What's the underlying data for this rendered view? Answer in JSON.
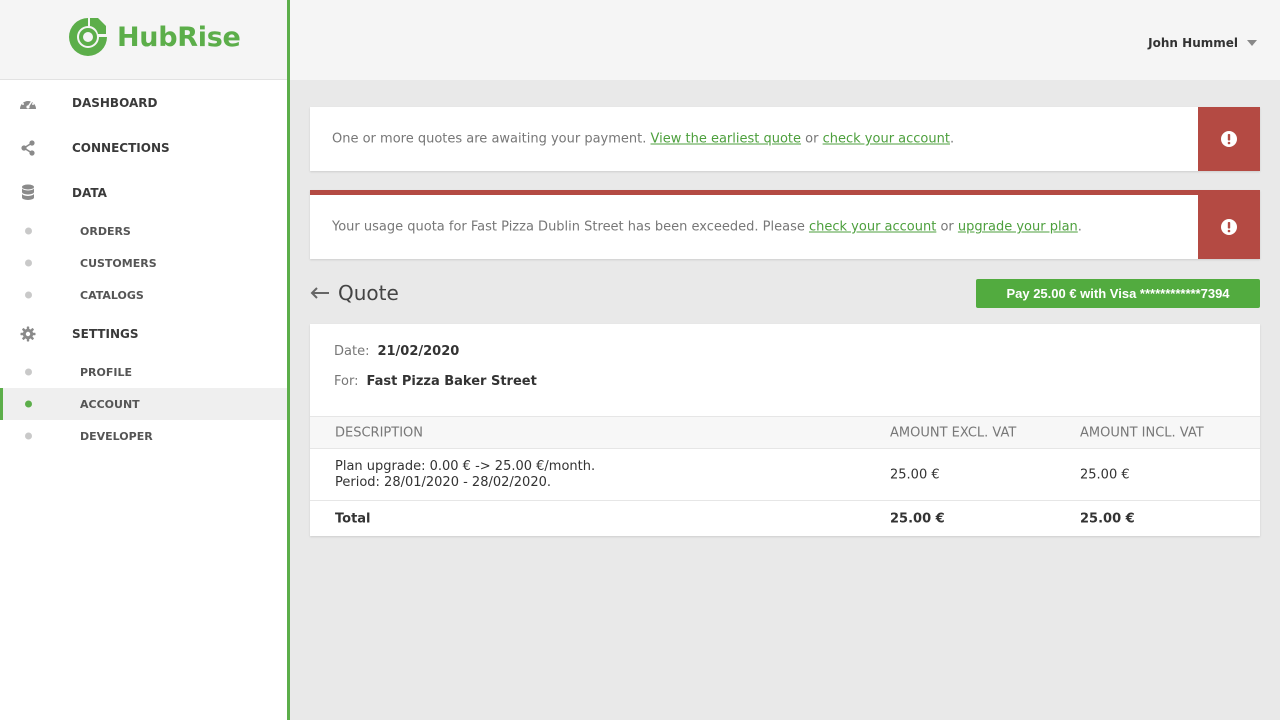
{
  "brand": {
    "name": "HubRise",
    "accent": "#5cae4a",
    "alert_color": "#b44a43"
  },
  "sidebar": {
    "items": [
      {
        "label": "DASHBOARD",
        "icon": "dashboard-icon"
      },
      {
        "label": "CONNECTIONS",
        "icon": "share-icon"
      },
      {
        "label": "DATA",
        "icon": "database-icon"
      },
      {
        "label": "ORDERS"
      },
      {
        "label": "CUSTOMERS"
      },
      {
        "label": "CATALOGS"
      },
      {
        "label": "SETTINGS",
        "icon": "gear-icon"
      },
      {
        "label": "PROFILE"
      },
      {
        "label": "ACCOUNT",
        "active": true
      },
      {
        "label": "DEVELOPER"
      }
    ]
  },
  "header": {
    "user_name": "John Hummel"
  },
  "alerts": [
    {
      "text_before": "One or more quotes are awaiting your payment. ",
      "link1": "View the earliest quote",
      "text_mid": " or ",
      "link2": "check your account",
      "text_after": ".",
      "icon": "exclamation-circle-icon"
    },
    {
      "text_before": "Your usage quota for Fast Pizza Dublin Street has been exceeded. Please ",
      "link1": "check your account",
      "text_mid": " or ",
      "link2": "upgrade your plan",
      "text_after": ".",
      "icon": "exclamation-circle-icon"
    }
  ],
  "quote": {
    "title": "Quote",
    "pay_button": "Pay 25.00 € with Visa ************7394",
    "date_label": "Date:",
    "date_value": "21/02/2020",
    "for_label": "For:",
    "for_value": "Fast Pizza Baker Street",
    "columns": [
      "DESCRIPTION",
      "AMOUNT EXCL. VAT",
      "AMOUNT INCL. VAT"
    ],
    "rows": [
      {
        "description_line1": "Plan upgrade: 0.00 € -> 25.00 €/month.",
        "description_line2": "Period: 28/01/2020 - 28/02/2020.",
        "excl": "25.00 €",
        "incl": "25.00 €"
      }
    ],
    "total": {
      "label": "Total",
      "excl": "25.00 €",
      "incl": "25.00 €"
    }
  }
}
